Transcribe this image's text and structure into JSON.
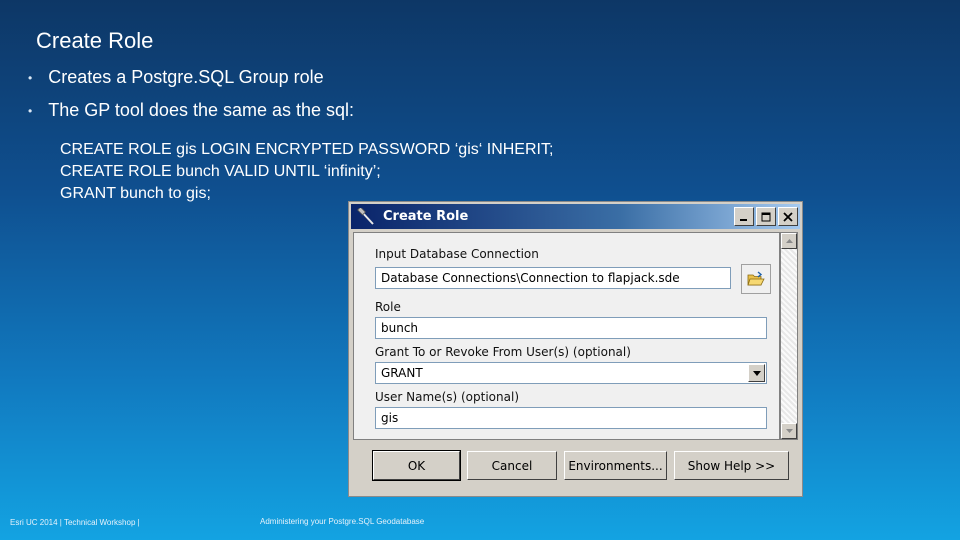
{
  "slide": {
    "title": "Create Role",
    "bullets": [
      "Creates a Postgre.SQL Group role",
      "The GP tool does the same as the sql:"
    ],
    "code_lines": [
      "CREATE ROLE gis LOGIN ENCRYPTED PASSWORD ‘gis‘ INHERIT;",
      "CREATE ROLE bunch VALID UNTIL ‘infinity’;",
      "GRANT bunch to gis;"
    ],
    "footer_left": "Esri UC 2014 | Technical Workshop |",
    "footer_center": "Administering your Postgre.SQL Geodatabase"
  },
  "dialog": {
    "title": "Create Role",
    "icon": "hammer-icon",
    "fields": {
      "input_db_label": "Input Database Connection",
      "input_db_value": "Database Connections\\Connection to flapjack.sde",
      "role_label": "Role",
      "role_value": "bunch",
      "grant_label": "Grant To or Revoke From User(s) (optional)",
      "grant_value": "GRANT",
      "username_label": "User Name(s) (optional)",
      "username_value": "gis"
    },
    "buttons": {
      "ok": "OK",
      "cancel": "Cancel",
      "environments": "Environments...",
      "show_help": "Show Help >>"
    },
    "colors": {
      "titlebar": "#0a246a",
      "face": "#d4d0c8"
    }
  }
}
